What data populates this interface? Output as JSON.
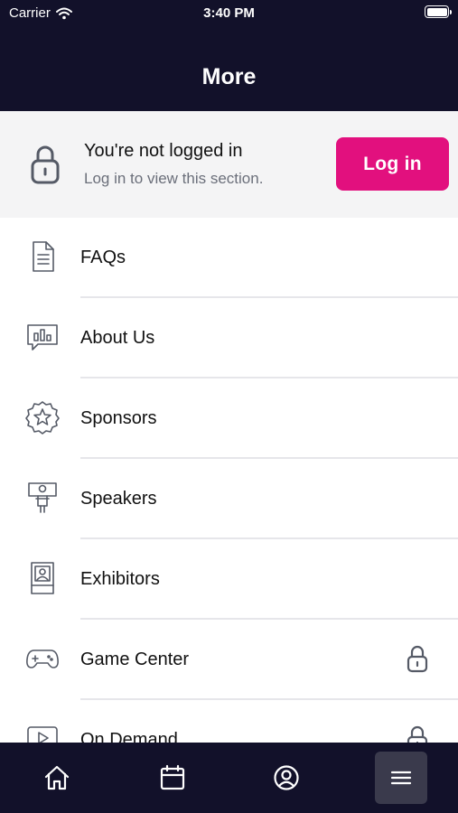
{
  "status_bar": {
    "carrier": "Carrier",
    "time": "3:40 PM"
  },
  "header": {
    "title": "More"
  },
  "login_banner": {
    "title": "You're not logged in",
    "subtitle": "Log in to view this section.",
    "button_label": "Log in",
    "icon": "lock-icon"
  },
  "menu": {
    "items": [
      {
        "label": "FAQs",
        "icon": "document-icon",
        "locked": false
      },
      {
        "label": "About Us",
        "icon": "chat-chart-icon",
        "locked": false
      },
      {
        "label": "Sponsors",
        "icon": "star-badge-icon",
        "locked": false
      },
      {
        "label": "Speakers",
        "icon": "speaker-podium-icon",
        "locked": false
      },
      {
        "label": "Exhibitors",
        "icon": "exhibitor-booth-icon",
        "locked": false
      },
      {
        "label": "Game Center",
        "icon": "gamepad-icon",
        "locked": true
      },
      {
        "label": "On Demand",
        "icon": "play-icon",
        "locked": true
      }
    ]
  },
  "tabbar": {
    "tabs": [
      {
        "name": "home",
        "icon": "home-icon",
        "active": false
      },
      {
        "name": "calendar",
        "icon": "calendar-icon",
        "active": false
      },
      {
        "name": "profile",
        "icon": "profile-icon",
        "active": false
      },
      {
        "name": "more",
        "icon": "menu-icon",
        "active": true
      }
    ]
  },
  "colors": {
    "header_bg": "#12112a",
    "accent": "#e2107e",
    "banner_bg": "#f4f4f5",
    "tab_active_bg": "#3a3a4c"
  }
}
